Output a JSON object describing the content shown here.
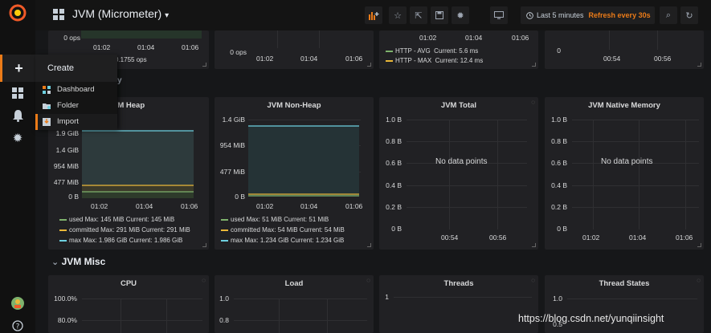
{
  "topbar": {
    "title": "JVM (Micrometer)",
    "caret": "▾",
    "time_range": "Last 5 minutes",
    "refresh": "Refresh every 30s"
  },
  "create_menu": {
    "title": "Create",
    "items": [
      {
        "label": "Dashboard"
      },
      {
        "label": "Folder"
      },
      {
        "label": "Import"
      }
    ]
  },
  "top_row": {
    "p1": {
      "y0": "0 ops",
      "x": [
        "01:02",
        "01:04",
        "01:06"
      ],
      "legend": "0.1755 ops"
    },
    "p2": {
      "y0": "0 ops",
      "x": [
        "01:02",
        "01:04",
        "01:06"
      ]
    },
    "p3": {
      "x": [
        "01:02",
        "01:04",
        "01:06"
      ],
      "legend": [
        {
          "name": "HTTP - AVG",
          "current": "Current: 5.6 ms",
          "color": "#7eb26d"
        },
        {
          "name": "HTTP - MAX",
          "current": "Current: 12.4 ms",
          "color": "#eab839"
        }
      ]
    },
    "p4": {
      "y0": "0",
      "x": [
        "00:54",
        "00:56"
      ]
    }
  },
  "row_memory_fragment": "y",
  "heap": {
    "title": "VM Heap",
    "yticks": [
      "1.9 GiB",
      "1.4 GiB",
      "954 MiB",
      "477 MiB",
      "0 B"
    ],
    "x": [
      "01:02",
      "01:04",
      "01:06"
    ],
    "legend": [
      {
        "text": "used  Max: 145 MiB  Current: 145 MiB",
        "color": "#7eb26d"
      },
      {
        "text": "committed  Max: 291 MiB  Current: 291 MiB",
        "color": "#eab839"
      },
      {
        "text": "max  Max: 1.986 GiB  Current: 1.986 GiB",
        "color": "#6ed0e0"
      }
    ]
  },
  "nonheap": {
    "title": "JVM Non-Heap",
    "yticks": [
      "1.4 GiB",
      "954 MiB",
      "477 MiB",
      "0 B"
    ],
    "x": [
      "01:02",
      "01:04",
      "01:06"
    ],
    "legend": [
      {
        "text": "used  Max: 51 MiB  Current: 51 MiB",
        "color": "#7eb26d"
      },
      {
        "text": "committed  Max: 54 MiB  Current: 54 MiB",
        "color": "#eab839"
      },
      {
        "text": "max  Max: 1.234 GiB  Current: 1.234 GiB",
        "color": "#6ed0e0"
      }
    ]
  },
  "total": {
    "title": "JVM Total",
    "yticks": [
      "1.0 B",
      "0.8 B",
      "0.6 B",
      "0.4 B",
      "0.2 B",
      "0 B"
    ],
    "x": [
      "00:54",
      "00:56"
    ],
    "nodata": "No data points"
  },
  "native": {
    "title": "JVM Native Memory",
    "yticks": [
      "1.0 B",
      "0.8 B",
      "0.6 B",
      "0.4 B",
      "0.2 B",
      "0 B"
    ],
    "x": [
      "01:02",
      "01:04",
      "01:06"
    ],
    "nodata": "No data points"
  },
  "misc_row": {
    "title": "JVM Misc",
    "chevron": "⌄"
  },
  "cpu": {
    "title": "CPU",
    "yticks": [
      "100.0%",
      "80.0%"
    ]
  },
  "load": {
    "title": "Load",
    "yticks": [
      "1.0",
      "0.8"
    ]
  },
  "threads": {
    "title": "Threads",
    "yticks": [
      "1"
    ]
  },
  "thread_states": {
    "title": "Thread States",
    "yticks": [
      "1.0",
      "0.5"
    ]
  },
  "watermark": "https://blog.csdn.net/yunqiinsight",
  "colors": {
    "accent": "#eb7b18",
    "used": "#7eb26d",
    "committed": "#eab839",
    "max": "#6ed0e0"
  }
}
